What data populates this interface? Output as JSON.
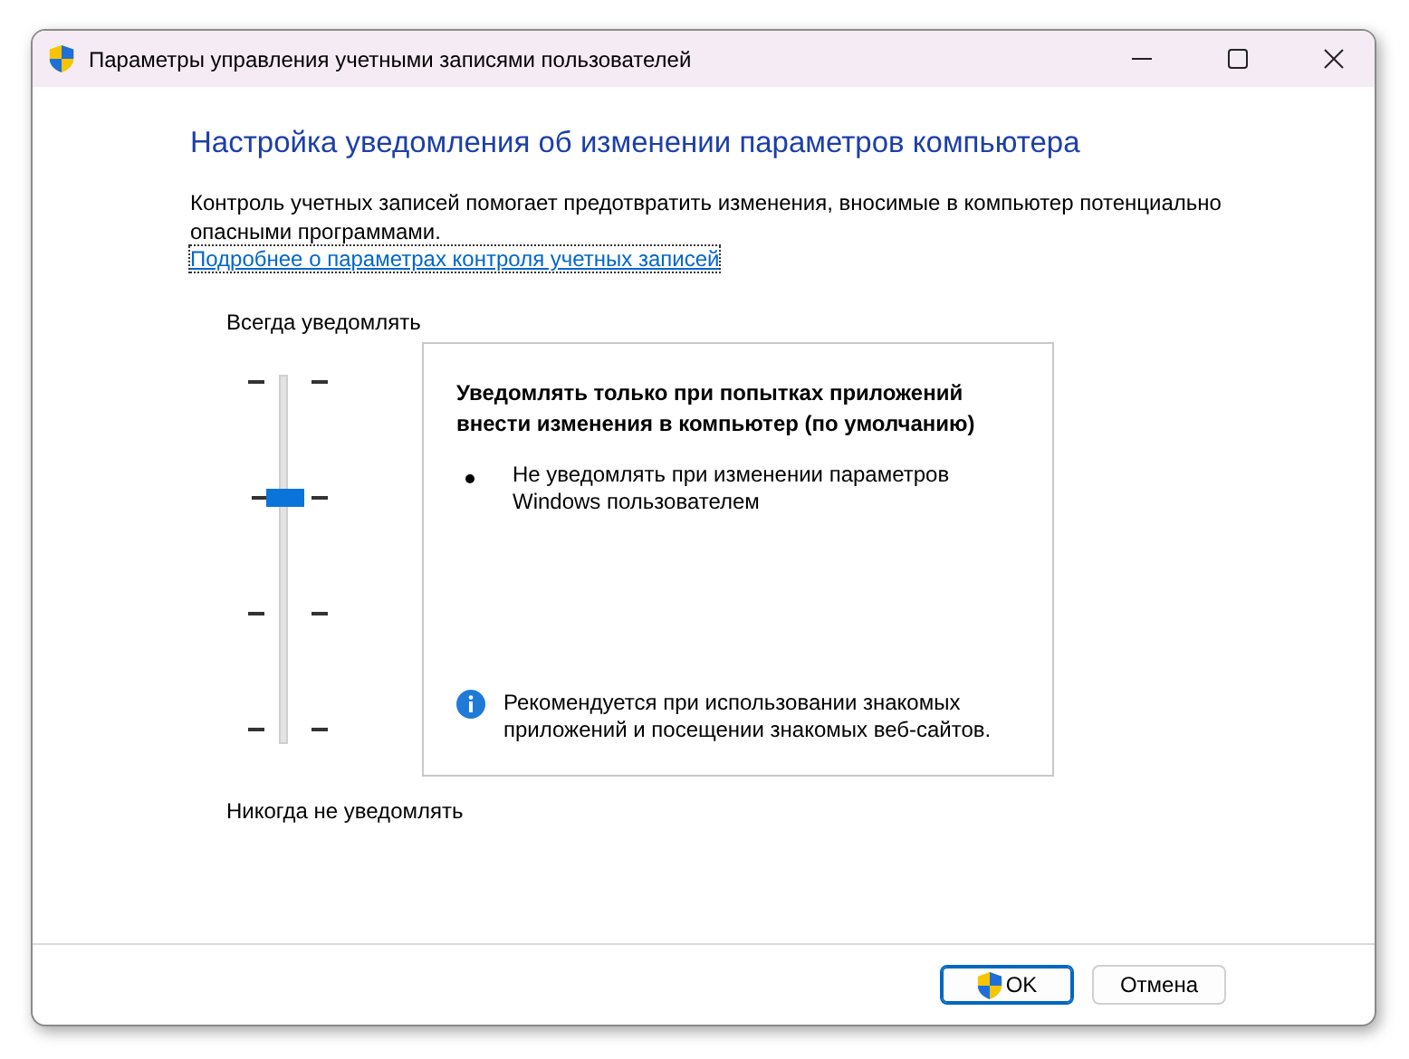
{
  "window": {
    "title": "Параметры управления учетными записями пользователей"
  },
  "heading": "Настройка уведомления об изменении параметров компьютера",
  "description": "Контроль учетных записей помогает предотвратить изменения, вносимые в компьютер потенциально опасными программами.",
  "link": "Подробнее о параметрах контроля учетных записей",
  "slider": {
    "top_label": "Всегда уведомлять",
    "bottom_label": "Никогда не уведомлять",
    "level": 0.667
  },
  "info_box": {
    "title": "Уведомлять только при попытках приложений внести изменения в компьютер (по умолчанию)",
    "bullets": [
      "Не уведомлять при изменении параметров Windows пользователем"
    ],
    "recommendation": "Рекомендуется при использовании знакомых приложений и посещении знакомых веб-сайтов."
  },
  "buttons": [
    {
      "label": "OK",
      "default": true,
      "kind": "shield"
    },
    {
      "label": "Отмена",
      "default": false,
      "kind": "plain"
    }
  ]
}
